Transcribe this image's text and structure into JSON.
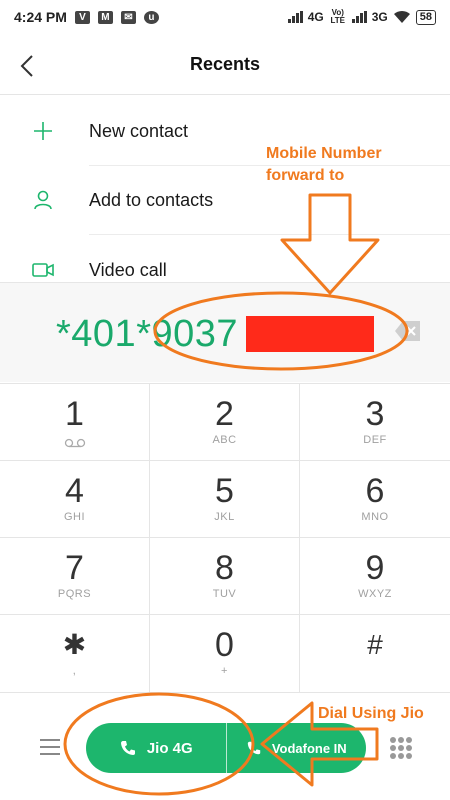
{
  "status_bar": {
    "time": "4:24 PM",
    "network_1": "4G",
    "volte_label": "Vo) LTE",
    "network_2": "3G",
    "battery": "58"
  },
  "header": {
    "title": "Recents"
  },
  "menu": {
    "items": [
      {
        "label": "New contact",
        "icon": "plus-icon"
      },
      {
        "label": "Add to contacts",
        "icon": "person-icon"
      },
      {
        "label": "Video call",
        "icon": "video-camera-icon"
      }
    ]
  },
  "dialer": {
    "number": "*401*9037"
  },
  "keypad": {
    "keys": [
      {
        "digit": "1",
        "letters": ""
      },
      {
        "digit": "2",
        "letters": "ABC"
      },
      {
        "digit": "3",
        "letters": "DEF"
      },
      {
        "digit": "4",
        "letters": "GHI"
      },
      {
        "digit": "5",
        "letters": "JKL"
      },
      {
        "digit": "6",
        "letters": "MNO"
      },
      {
        "digit": "7",
        "letters": "PQRS"
      },
      {
        "digit": "8",
        "letters": "TUV"
      },
      {
        "digit": "9",
        "letters": "WXYZ"
      },
      {
        "digit": "✱",
        "letters": ","
      },
      {
        "digit": "0",
        "letters": "+"
      },
      {
        "digit": "#",
        "letters": ""
      }
    ]
  },
  "call_bar": {
    "sim1_label": "Jio 4G",
    "sim2_label": "Vodafone IN"
  },
  "annotations": {
    "forward_note_line1": "Mobile Number",
    "forward_note_line2": "forward to",
    "dial_note": "Dial Using Jio",
    "color": "#f07a1f"
  },
  "colors": {
    "accent_green": "#1db66d",
    "number_green": "#1aa96b",
    "redaction": "#ff2a1a"
  }
}
